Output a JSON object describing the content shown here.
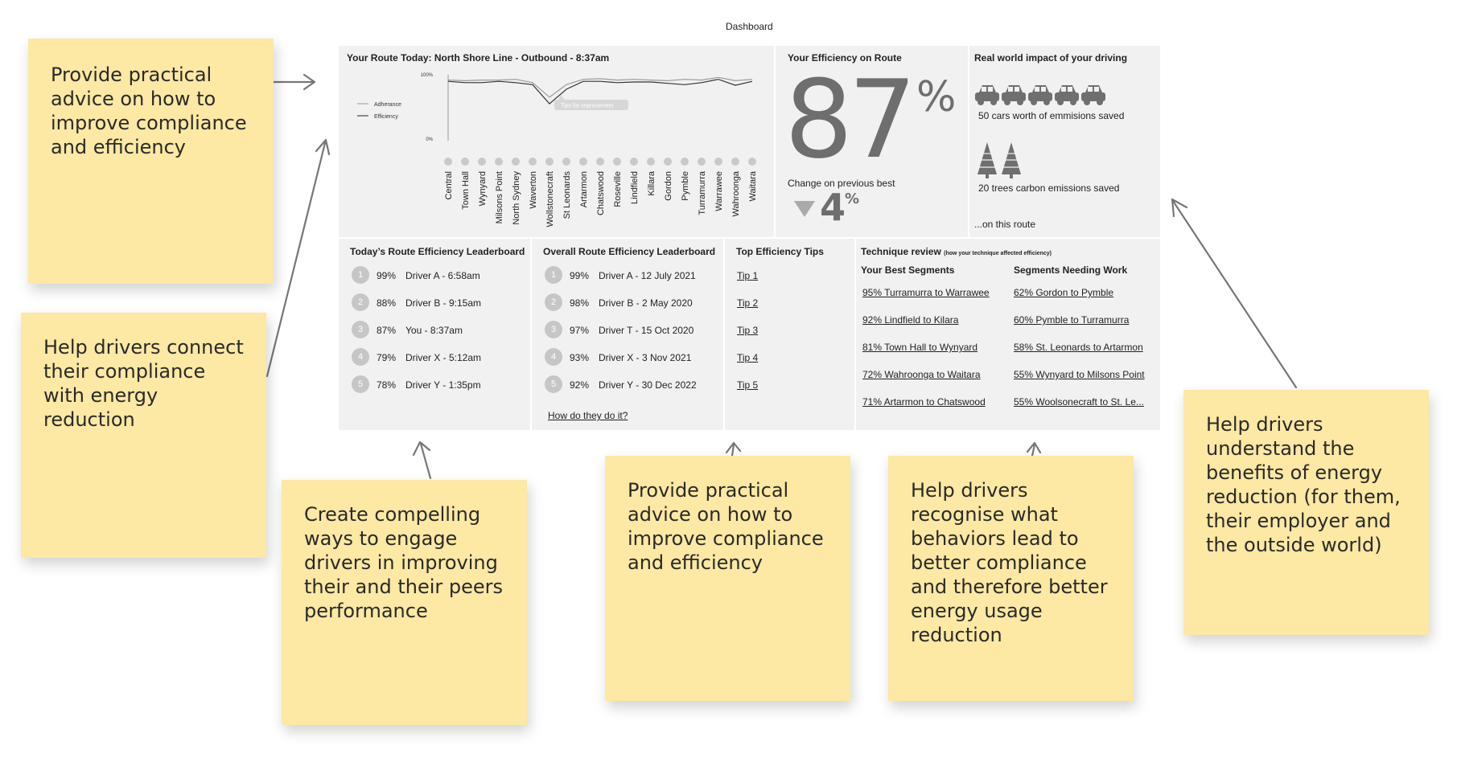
{
  "title": "Dashboard",
  "stickies": [
    {
      "text": "Provide practical advice on how to improve compliance and efficiency"
    },
    {
      "text": "Help drivers connect their compliance with energy reduction"
    },
    {
      "text": "Create compelling ways to engage drivers in improving their and their peers performance"
    },
    {
      "text": "Provide practical advice on how to improve compliance and efficiency"
    },
    {
      "text": "Help drivers recognise what behaviors lead to better compliance and therefore better energy usage reduction"
    },
    {
      "text": "Help drivers understand the benefits of energy reduction (for them, their employer and the outside world)"
    }
  ],
  "route": {
    "title": "Your Route Today: North Shore Line - Outbound -  8:37am",
    "legend": [
      "Adherance",
      "Efficiency"
    ],
    "y_top": "100%",
    "y_bottom": "0%",
    "tooltip": "Tips for improvement",
    "stations": [
      "Central",
      "Town Hall",
      "Wynyard",
      "Milsons Point",
      "North Sydney",
      "Waverton",
      "Wollstonecraft",
      "St Leonards",
      "Artarmon",
      "Chatswood",
      "Roseville",
      "Lindfield",
      "Killara",
      "Gordon",
      "Pymble",
      "Turramurra",
      "Warrawee",
      "Wahroonga",
      "Waitara"
    ]
  },
  "chart_data": {
    "type": "line",
    "categories": [
      "Central",
      "Town Hall",
      "Wynyard",
      "Milsons Point",
      "North Sydney",
      "Waverton",
      "Wollstonecraft",
      "St Leonards",
      "Artarmon",
      "Chatswood",
      "Roseville",
      "Lindfield",
      "Killara",
      "Gordon",
      "Pymble",
      "Turramurra",
      "Warrawee",
      "Wahroonga",
      "Waitara"
    ],
    "ylim": [
      0,
      100
    ],
    "series": [
      {
        "name": "Adherance",
        "values": [
          92,
          91,
          92,
          92,
          93,
          88,
          66,
          85,
          93,
          94,
          92,
          93,
          92,
          91,
          93,
          92,
          96,
          91,
          93
        ]
      },
      {
        "name": "Efficiency",
        "values": [
          90,
          88,
          88,
          90,
          88,
          85,
          56,
          78,
          90,
          90,
          88,
          89,
          89,
          87,
          85,
          88,
          93,
          84,
          90
        ]
      }
    ]
  },
  "efficiency": {
    "title": "Your Efficiency on Route",
    "value": "87",
    "unit": "%",
    "change_label": "Change on previous best",
    "change_value": "4",
    "change_unit": "%"
  },
  "impact": {
    "title": "Real  world impact of your driving",
    "cars_text": "50 cars worth of emmisions saved",
    "trees_text": "20 trees  carbon emissions saved",
    "footer": "...on this route"
  },
  "today_board": {
    "title": "Today’s Route Efficiency Leaderboard",
    "rows": [
      {
        "rank": "1",
        "pct": "99%",
        "name": "Driver A - 6:58am"
      },
      {
        "rank": "2",
        "pct": "88%",
        "name": "Driver B - 9:15am"
      },
      {
        "rank": "3",
        "pct": "87%",
        "name": "You - 8:37am"
      },
      {
        "rank": "4",
        "pct": "79%",
        "name": "Driver X - 5:12am"
      },
      {
        "rank": "5",
        "pct": "78%",
        "name": "Driver Y - 1:35pm"
      }
    ]
  },
  "overall_board": {
    "title": "Overall Route Efficiency Leaderboard",
    "rows": [
      {
        "rank": "1",
        "pct": "99%",
        "name": "Driver A - 12 July 2021"
      },
      {
        "rank": "2",
        "pct": "98%",
        "name": "Driver B - 2 May 2020"
      },
      {
        "rank": "3",
        "pct": "97%",
        "name": "Driver T - 15 Oct 2020"
      },
      {
        "rank": "4",
        "pct": "93%",
        "name": "Driver X - 3 Nov 2021"
      },
      {
        "rank": "5",
        "pct": "92%",
        "name": "Driver Y - 30 Dec 2022"
      }
    ],
    "link": "How do they do it?"
  },
  "tips": {
    "title": "Top Efficiency Tips",
    "items": [
      "Tip 1",
      "Tip 2",
      "Tip 3",
      "Tip 4",
      "Tip 5"
    ]
  },
  "technique": {
    "title": "Technique review",
    "subtitle": "(how your technique affected efficiency)",
    "best_title": "Your Best Segments",
    "work_title": "Segments Needing Work",
    "best": [
      "95% Turramurra to Warrawee",
      "92% Lindfield to Kilara",
      "81% Town Hall to Wynyard",
      "72% Wahroonga to Waitara",
      "71% Artarmon to Chatswood"
    ],
    "work": [
      "62% Gordon to Pymble",
      "60% Pymble to Turramurra",
      "58% St. Leonards to Artarmon",
      "55% Wynyard to Milsons Point",
      "55% Woolsonecraft to St. Le..."
    ]
  },
  "colors": {
    "sticky": "#fde8a4",
    "panel": "#f1f1f1",
    "dark": "#6e6e6e",
    "rank": "#c6c6c6",
    "arrow": "#777777"
  }
}
